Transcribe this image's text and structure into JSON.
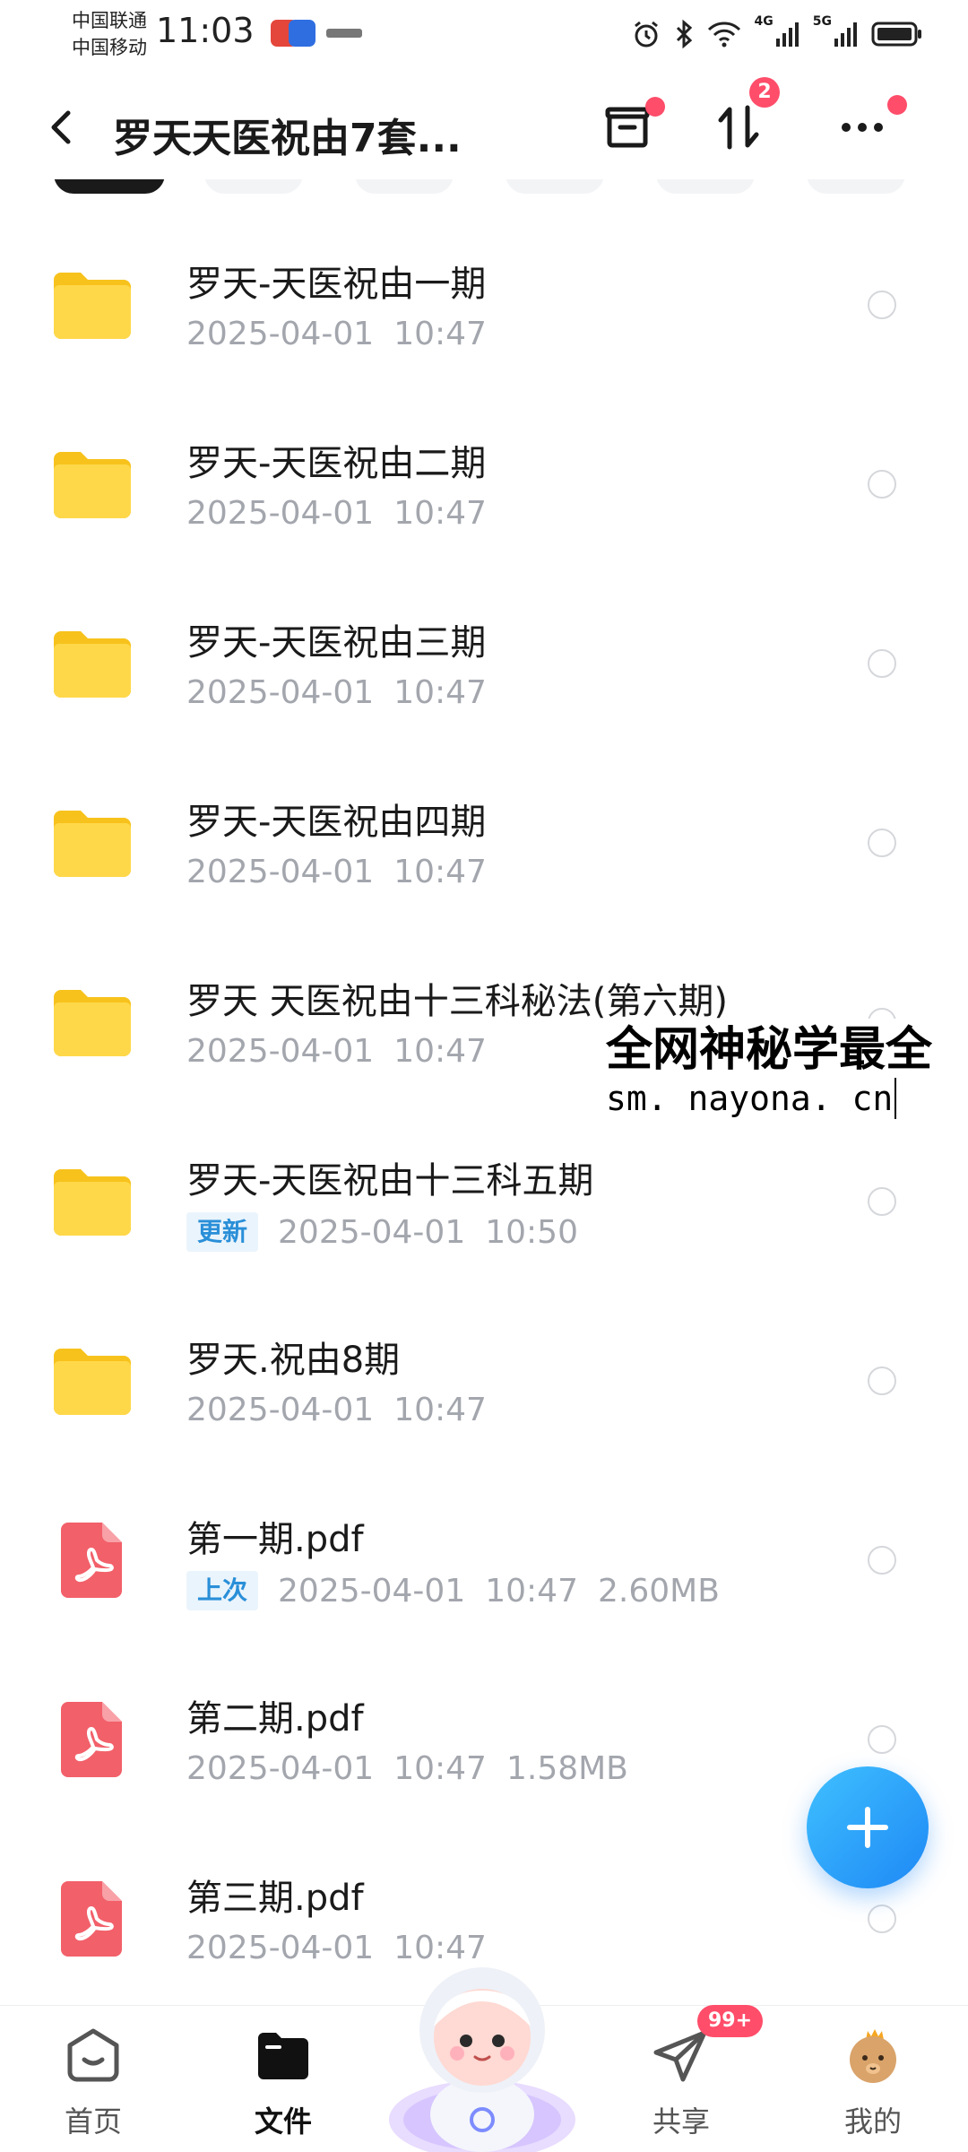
{
  "status_bar": {
    "carrier_1": "中国联通",
    "carrier_2": "中国移动",
    "time": "11:03",
    "network_1": "4G",
    "network_2": "5G"
  },
  "header": {
    "title": "罗天天医祝由7套...",
    "sort_badge": "2",
    "icons": [
      "back-icon",
      "archive-icon",
      "sort-icon",
      "more-icon"
    ]
  },
  "files": [
    {
      "name": "罗天-天医祝由一期",
      "tag": "",
      "date": "2025-04-01",
      "time": "10:47",
      "size": "",
      "kind": "folder"
    },
    {
      "name": "罗天-天医祝由二期",
      "tag": "",
      "date": "2025-04-01",
      "time": "10:47",
      "size": "",
      "kind": "folder"
    },
    {
      "name": "罗天-天医祝由三期",
      "tag": "",
      "date": "2025-04-01",
      "time": "10:47",
      "size": "",
      "kind": "folder"
    },
    {
      "name": "罗天-天医祝由四期",
      "tag": "",
      "date": "2025-04-01",
      "time": "10:47",
      "size": "",
      "kind": "folder"
    },
    {
      "name": "罗天 天医祝由十三科秘法(第六期)",
      "tag": "",
      "date": "2025-04-01",
      "time": "10:47",
      "size": "",
      "kind": "folder"
    },
    {
      "name": "罗天-天医祝由十三科五期",
      "tag": "更新",
      "date": "2025-04-01",
      "time": "10:50",
      "size": "",
      "kind": "folder"
    },
    {
      "name": "罗天.祝由8期",
      "tag": "",
      "date": "2025-04-01",
      "time": "10:47",
      "size": "",
      "kind": "folder"
    },
    {
      "name": "第一期.pdf",
      "tag": "上次",
      "date": "2025-04-01",
      "time": "10:47",
      "size": "2.60MB",
      "kind": "pdf"
    },
    {
      "name": "第二期.pdf",
      "tag": "",
      "date": "2025-04-01",
      "time": "10:47",
      "size": "1.58MB",
      "kind": "pdf"
    },
    {
      "name": "第三期.pdf",
      "tag": "",
      "date": "2025-04-01",
      "time": "10:47",
      "size": "",
      "kind": "pdf"
    }
  ],
  "watermark": {
    "line1": "全网神秘学最全",
    "line2": "sm. nayona. cn"
  },
  "fab": {
    "icon": "plus-icon"
  },
  "bottom_nav": {
    "items": [
      {
        "label": "首页",
        "icon": "home-icon",
        "active": false
      },
      {
        "label": "文件",
        "icon": "folder-icon",
        "active": true
      },
      {
        "label": "共享",
        "icon": "paper-plane-icon",
        "active": false
      },
      {
        "label": "我的",
        "icon": "avatar-icon",
        "active": false
      }
    ],
    "share_badge": "99+"
  },
  "colors": {
    "accent": "#1e88f5",
    "badge": "#ff4d6a",
    "folder": "#ffd233",
    "pdf": "#f2606a",
    "tag": "#2a8fd8",
    "meta_text": "#a3a6ad"
  }
}
